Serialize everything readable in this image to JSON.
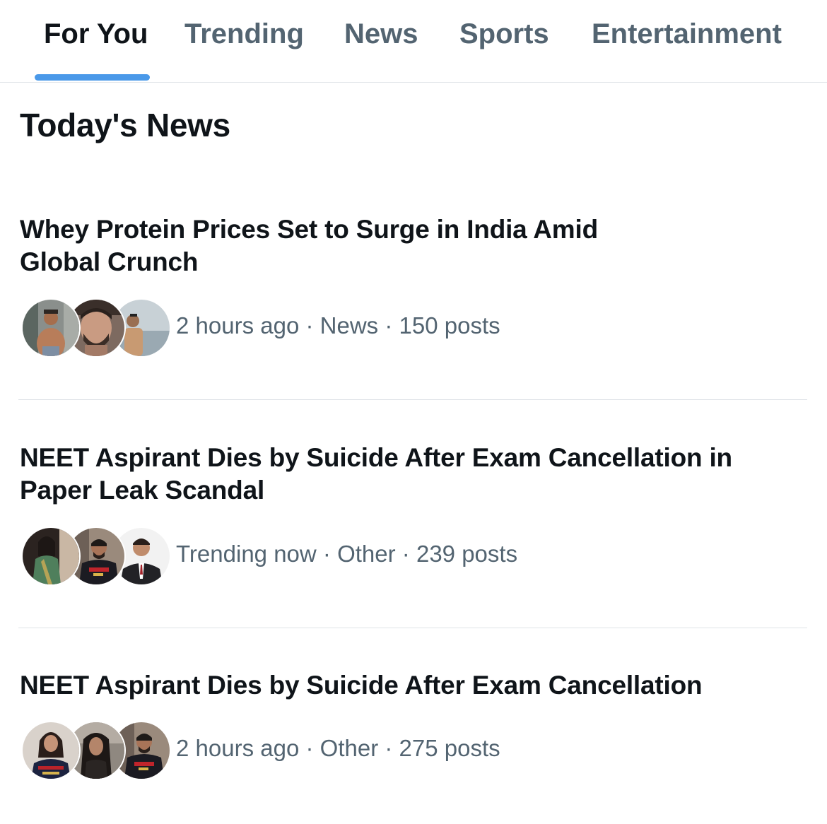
{
  "tabs": [
    {
      "label": "For You",
      "active": true
    },
    {
      "label": "Trending",
      "active": false
    },
    {
      "label": "News",
      "active": false
    },
    {
      "label": "Sports",
      "active": false
    },
    {
      "label": "Entertainment",
      "active": false
    }
  ],
  "colors": {
    "accent": "#4a99e9",
    "primary_text": "#0f1419",
    "secondary_text": "#536471"
  },
  "section_title": "Today's News",
  "stories": [
    {
      "headline_line1": "Whey Protein Prices Set to Surge in India Amid",
      "headline_line2": "Global Crunch",
      "time": "2 hours ago",
      "category": "News",
      "posts": "150 posts",
      "avatars": [
        "fitness-man-photo",
        "bearded-man-photo",
        "beach-man-photo"
      ]
    },
    {
      "headline_line1": "NEET Aspirant Dies by Suicide After Exam Cancellation in",
      "headline_line2": "Paper Leak Scandal",
      "time": "Trending now",
      "category": "Other",
      "posts": "239 posts",
      "avatars": [
        "woman-saree-photo",
        "cricketer-jersey-photo",
        "man-suit-photo"
      ]
    },
    {
      "headline_line1": "NEET Aspirant Dies by Suicide After Exam Cancellation",
      "time": "2 hours ago",
      "category": "Other",
      "posts": "275 posts",
      "avatars": [
        "woman-jersey-photo",
        "woman-dark-photo",
        "cricketer-jersey-photo"
      ]
    }
  ],
  "separator": "·"
}
